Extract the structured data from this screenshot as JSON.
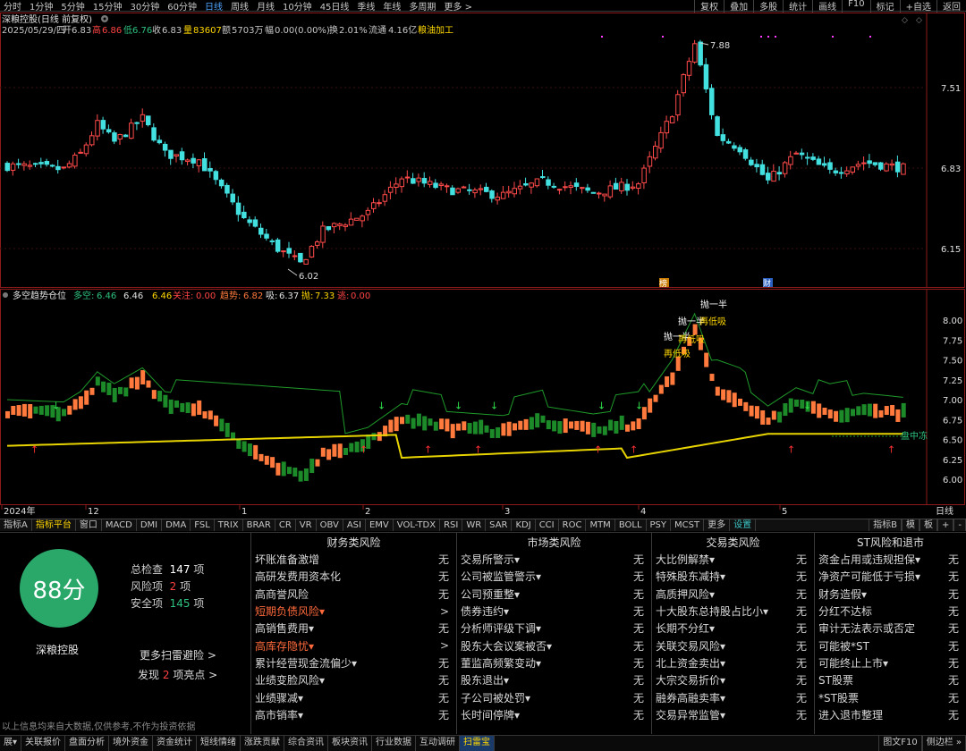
{
  "periods": [
    "分时",
    "1分钟",
    "5分钟",
    "15分钟",
    "30分钟",
    "60分钟",
    "日线",
    "周线",
    "月线",
    "10分钟",
    "45日线",
    "季线",
    "年线",
    "多周期",
    "更多 >"
  ],
  "active_period": "日线",
  "toolbar": [
    "复权",
    "叠加",
    "多股",
    "统计",
    "画线",
    "F10",
    "标记",
    "+自选",
    "返回"
  ],
  "chart": {
    "title": "深粮控股(日线 前复权)",
    "info_date": "2025/05/29/四",
    "info_open_label": "开",
    "info_open": "6.83",
    "info_high_label": "高",
    "info_high": "6.86",
    "info_low_label": "低",
    "info_low": "6.76",
    "info_close_label": "收",
    "info_close": "6.83",
    "info_vol_label": "量",
    "info_vol": "83607",
    "info_amt_label": "额",
    "info_amt": "5703万",
    "info_chg_label": "幅",
    "info_chg": "0.00(0.00%)",
    "info_turn_label": "换",
    "info_turn": "2.01%",
    "info_float_label": "流通",
    "info_float": "4.16亿",
    "info_sector": "粮油加工",
    "price_ticks": [
      "7.51",
      "6.83",
      "6.15"
    ],
    "max_mark": "7.88",
    "min_mark": "6.02",
    "event_labels": [
      "榜",
      "财"
    ]
  },
  "indicator": {
    "name": "多空趋势仓位",
    "duo_label": "多空:",
    "duo_val": "6.46",
    "v2": "6.46",
    "v3": "6.46",
    "guanzhu_label": "关注:",
    "guanzhu_val": "0.00",
    "qushi_label": "趋势:",
    "qushi_val": "6.82",
    "xi_label": "吸:",
    "xi_val": "6.37",
    "pao_label": "抛:",
    "pao_val": "7.33",
    "tao_label": "逃:",
    "tao_val": "0.00",
    "yticks": [
      "8.00",
      "7.75",
      "7.50",
      "7.25",
      "7.00",
      "6.75",
      "6.50",
      "6.25",
      "6.00"
    ],
    "annots": [
      "抛一半",
      "抛一半",
      "再低吸",
      "抛一半",
      "再低吸",
      "再低吸"
    ],
    "right_label": "盘中冻",
    "months": [
      "2024年",
      "12",
      "1",
      "2",
      "3",
      "4",
      "5"
    ],
    "period_label": "日线"
  },
  "ind_tabs": [
    "指标A",
    "指标平台",
    "窗口",
    "MACD",
    "DMI",
    "DMA",
    "FSL",
    "TRIX",
    "BRAR",
    "CR",
    "VR",
    "OBV",
    "ASI",
    "EMV",
    "VOL-TDX",
    "RSI",
    "WR",
    "SAR",
    "KDJ",
    "CCI",
    "ROC",
    "MTM",
    "BOLL",
    "PSY",
    "MCST",
    "更多",
    "设置"
  ],
  "ind_tabs_right": [
    "指标B",
    "模",
    "板",
    "+",
    "-"
  ],
  "score": {
    "value": "88分",
    "stock": "深粮控股",
    "check_label": "总检查",
    "check_val": "147",
    "risk_label": "风险项",
    "risk_val": "2",
    "safe_label": "安全项",
    "safe_val": "145",
    "unit": "项",
    "more": "更多扫雷避险 >",
    "found_prefix": "发现",
    "found_val": "2",
    "found_suffix": "项亮点 >",
    "disclaimer": "以上信息均来自大数据,仅供参考,不作为投资依据"
  },
  "risk_columns": [
    {
      "title": "财务类风险",
      "items": [
        {
          "label": "坏账准备激增",
          "val": "无",
          "warn": false
        },
        {
          "label": "高研发费用资本化",
          "val": "无",
          "warn": false
        },
        {
          "label": "高商誉风险",
          "val": "无",
          "warn": false
        },
        {
          "label": "短期负债风险▾",
          "val": ">",
          "warn": true
        },
        {
          "label": "高销售费用▾",
          "val": "无",
          "warn": false
        },
        {
          "label": "高库存隐忧▾",
          "val": ">",
          "warn": true
        },
        {
          "label": "累计经营现金流偏少▾",
          "val": "无",
          "warn": false
        },
        {
          "label": "业绩变脸风险▾",
          "val": "无",
          "warn": false
        },
        {
          "label": "业绩骤减▾",
          "val": "无",
          "warn": false
        },
        {
          "label": "高市销率▾",
          "val": "无",
          "warn": false
        }
      ]
    },
    {
      "title": "市场类风险",
      "items": [
        {
          "label": "交易所警示▾",
          "val": "无",
          "warn": false
        },
        {
          "label": "公司被监管警示▾",
          "val": "无",
          "warn": false
        },
        {
          "label": "公司预重整▾",
          "val": "无",
          "warn": false
        },
        {
          "label": "债券违约▾",
          "val": "无",
          "warn": false
        },
        {
          "label": "分析师评级下调▾",
          "val": "无",
          "warn": false
        },
        {
          "label": "股东大会议案被否▾",
          "val": "无",
          "warn": false
        },
        {
          "label": "董监高频繁变动▾",
          "val": "无",
          "warn": false
        },
        {
          "label": "股东退出▾",
          "val": "无",
          "warn": false
        },
        {
          "label": "子公司被处罚▾",
          "val": "无",
          "warn": false
        },
        {
          "label": "长时间停牌▾",
          "val": "无",
          "warn": false
        }
      ]
    },
    {
      "title": "交易类风险",
      "items": [
        {
          "label": "大比例解禁▾",
          "val": "无",
          "warn": false
        },
        {
          "label": "特殊股东减持▾",
          "val": "无",
          "warn": false
        },
        {
          "label": "高质押风险▾",
          "val": "无",
          "warn": false
        },
        {
          "label": "十大股东总持股占比小▾",
          "val": "无",
          "warn": false
        },
        {
          "label": "长期不分红▾",
          "val": "无",
          "warn": false
        },
        {
          "label": "关联交易风险▾",
          "val": "无",
          "warn": false
        },
        {
          "label": "北上资金卖出▾",
          "val": "无",
          "warn": false
        },
        {
          "label": "大宗交易折价▾",
          "val": "无",
          "warn": false
        },
        {
          "label": "融券高融卖率▾",
          "val": "无",
          "warn": false
        },
        {
          "label": "交易异常监管▾",
          "val": "无",
          "warn": false
        }
      ]
    },
    {
      "title": "ST风险和退市",
      "items": [
        {
          "label": "资金占用或违规担保▾",
          "val": "无",
          "warn": false
        },
        {
          "label": "净资产可能低于亏损▾",
          "val": "无",
          "warn": false
        },
        {
          "label": "财务造假▾",
          "val": "无",
          "warn": false
        },
        {
          "label": "分红不达标",
          "val": "无",
          "warn": false
        },
        {
          "label": "审计无法表示或否定",
          "val": "无",
          "warn": false
        },
        {
          "label": "可能被*ST",
          "val": "无",
          "warn": false
        },
        {
          "label": "可能终止上市▾",
          "val": "无",
          "warn": false
        },
        {
          "label": "ST股票",
          "val": "无",
          "warn": false
        },
        {
          "label": "*ST股票",
          "val": "无",
          "warn": false
        },
        {
          "label": "进入退市整理",
          "val": "无",
          "warn": false
        }
      ]
    }
  ],
  "status_tabs": [
    "展▾",
    "关联报价",
    "盘面分析",
    "境外资金",
    "资金统计",
    "短线情绪",
    "涨跌贡献",
    "综合资讯",
    "板块资讯",
    "行业数据",
    "互动调研",
    "扫雷宝"
  ],
  "status_active": "扫雷宝",
  "status_right": [
    "图文F10",
    "侧边栏 »"
  ]
}
